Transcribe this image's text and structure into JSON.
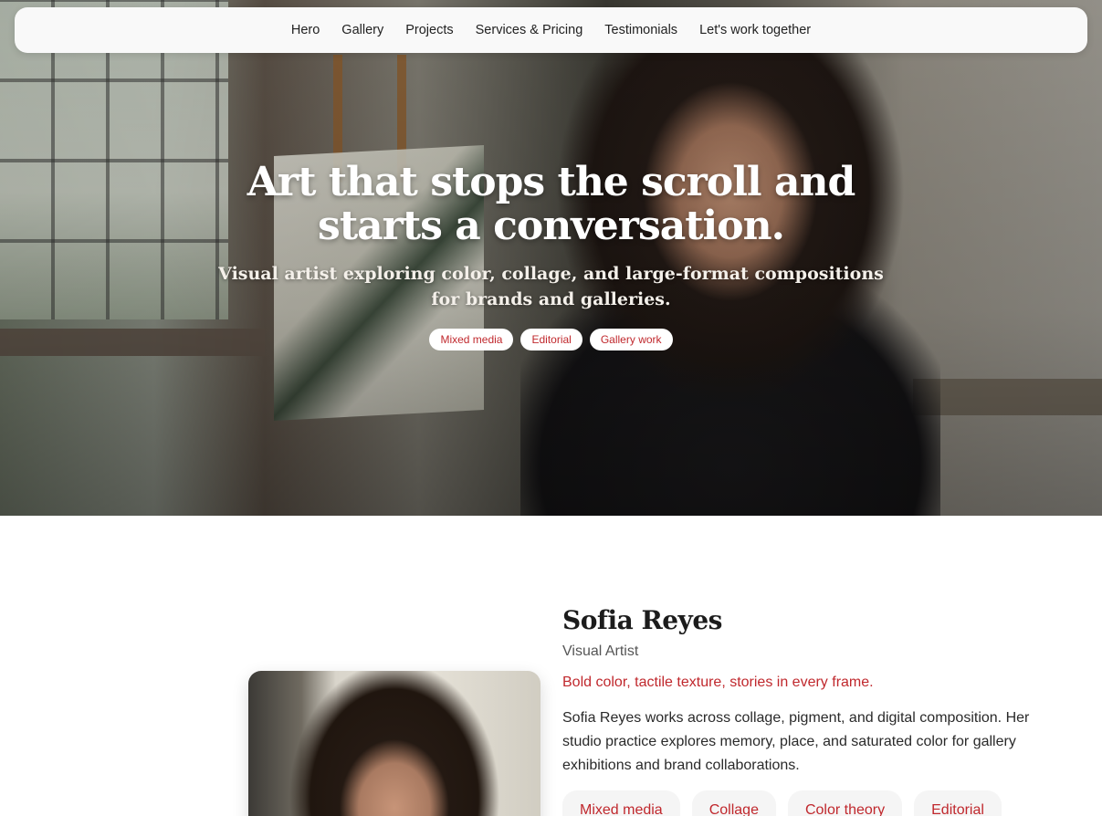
{
  "nav": {
    "items": [
      "Hero",
      "Gallery",
      "Projects",
      "Services & Pricing",
      "Testimonials",
      "Let's work together"
    ]
  },
  "hero": {
    "title": "Art that stops the scroll and starts a conversation.",
    "subtitle": "Visual artist exploring color, collage, and large-format compositions for brands and galleries.",
    "tags": [
      "Mixed media",
      "Editorial",
      "Gallery work"
    ]
  },
  "about": {
    "name": "Sofia Reyes",
    "role": "Visual Artist",
    "tagline": "Bold color, tactile texture, stories in every frame.",
    "bio": "Sofia Reyes works across collage, pigment, and digital composition. Her studio practice explores memory, place, and saturated color for gallery exhibitions and brand collaborations.",
    "skills": [
      "Mixed media",
      "Collage",
      "Color theory",
      "Editorial"
    ]
  },
  "colors": {
    "accent": "#c0282d",
    "nav_bg": "#f9f9f9",
    "text": "#222222"
  }
}
